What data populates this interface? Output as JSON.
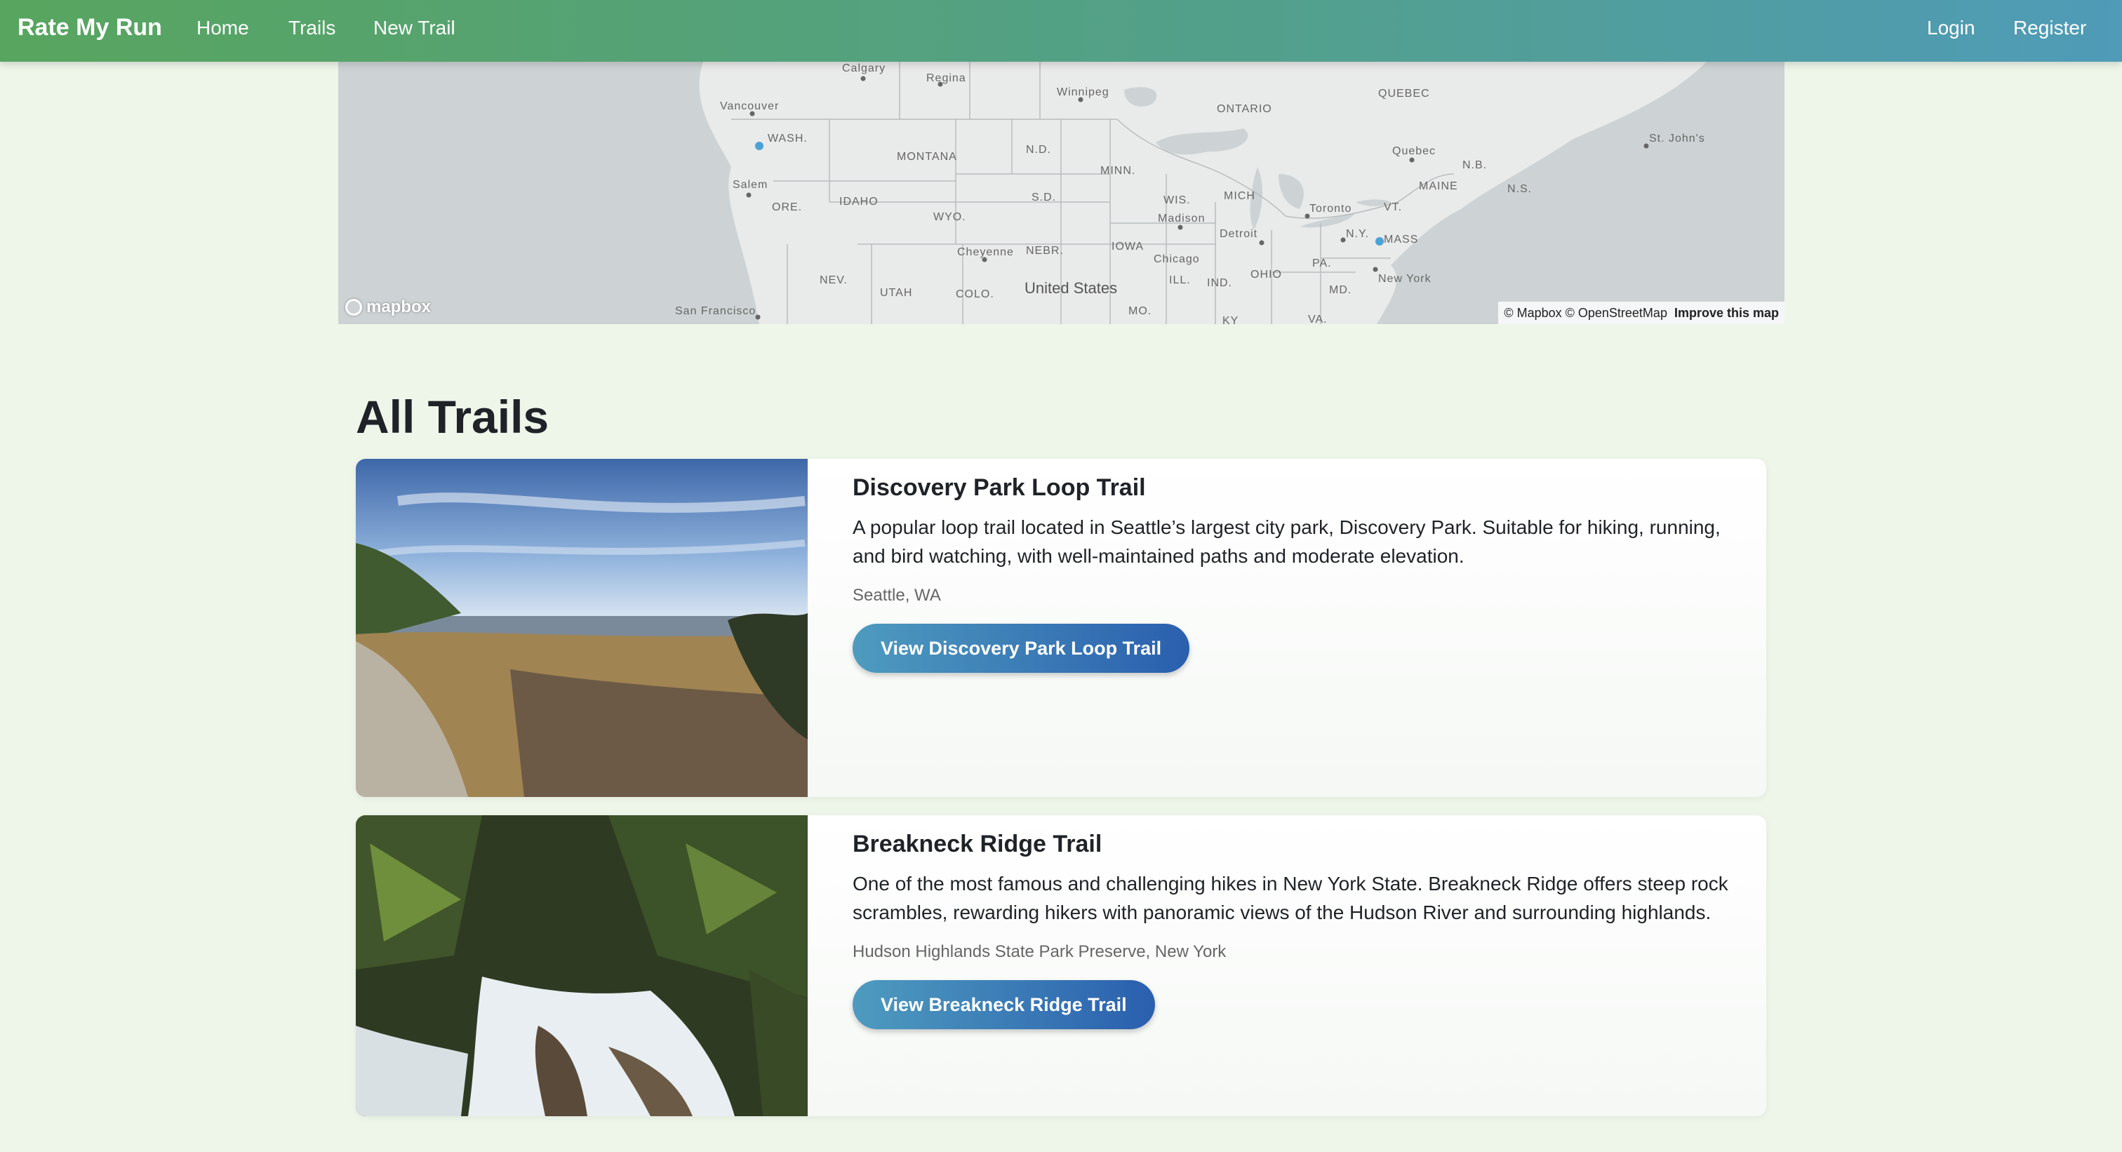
{
  "nav": {
    "brand": "Rate My Run",
    "links": [
      "Home",
      "Trails",
      "New Trail"
    ],
    "auth": [
      "Login",
      "Register"
    ]
  },
  "map": {
    "logo": "mapbox",
    "attribution": "© Mapbox © OpenStreetMap",
    "improve": "Improve this map",
    "labels": {
      "calgary": "Calgary",
      "regina": "Regina",
      "winnipeg": "Winnipeg",
      "quebec_prov": "QUEBEC",
      "ontario": "ONTARIO",
      "vancouver": "Vancouver",
      "wash": "WASH.",
      "montana": "MONTANA",
      "nd": "N.D.",
      "minn": "MINN.",
      "quebec_city": "Quebec",
      "nb": "N.B.",
      "stjohns": "St. John's",
      "ns": "N.S.",
      "maine": "MAINE",
      "salem": "Salem",
      "ore": "ORE.",
      "idaho": "IDAHO",
      "sd": "S.D.",
      "wyo": "WYO.",
      "wis": "WIS.",
      "mich": "MICH",
      "madison": "Madison",
      "toronto": "Toronto",
      "vt": "VT.",
      "detroit": "Detroit",
      "ny": "N.Y.",
      "mass": "MASS",
      "cheyenne": "Cheyenne",
      "nebr": "NEBR.",
      "iowa": "IOWA",
      "chicago": "Chicago",
      "pa": "PA.",
      "nev": "NEV.",
      "utah": "UTAH",
      "colo": "COLO.",
      "us": "United States",
      "ill": "ILL.",
      "ind": "IND.",
      "ohio": "OHIO",
      "newyork": "New York",
      "md": "MD.",
      "sf": "San Francisco",
      "mo": "MO.",
      "ky": "KY",
      "va": "VA."
    }
  },
  "page": {
    "title": "All Trails"
  },
  "trails": [
    {
      "title": "Discovery Park Loop Trail",
      "description": "A popular loop trail located in Seattle’s largest city park, Discovery Park. Suitable for hiking, running, and bird watching, with well-maintained paths and moderate elevation.",
      "location": "Seattle, WA",
      "button": "View Discovery Park Loop Trail"
    },
    {
      "title": "Breakneck Ridge Trail",
      "description": "One of the most famous and challenging hikes in New York State. Breakneck Ridge offers steep rock scrambles, rewarding hikers with panoramic views of the Hudson River and surrounding highlands.",
      "location": "Hudson Highlands State Park Preserve, New York",
      "button": "View Breakneck Ridge Trail"
    }
  ]
}
